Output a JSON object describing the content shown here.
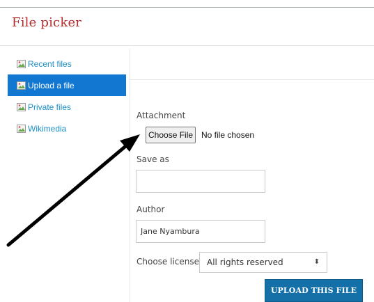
{
  "dialog": {
    "title": "File picker"
  },
  "sidebar": {
    "items": [
      {
        "label": "Recent files",
        "icon": "broken-image-icon",
        "active": false
      },
      {
        "label": "Upload a file",
        "icon": "broken-image-icon",
        "active": true
      },
      {
        "label": "Private files",
        "icon": "broken-image-icon",
        "active": false
      },
      {
        "label": "Wikimedia",
        "icon": "broken-image-icon",
        "active": false
      }
    ]
  },
  "form": {
    "attachment_label": "Attachment",
    "choose_file_label": "Choose File",
    "file_status": "No file chosen",
    "save_as_label": "Save as",
    "save_as_value": "",
    "author_label": "Author",
    "author_value": "Jane Nyambura",
    "license_label": "Choose license",
    "license_value": "All rights reserved",
    "upload_label": "UPLOAD THIS FILE"
  },
  "colors": {
    "title": "#b32c2c",
    "sidebar_link": "#1a8fc7",
    "sidebar_active_bg": "#1177d1",
    "upload_button_bg": "#1670a8"
  }
}
